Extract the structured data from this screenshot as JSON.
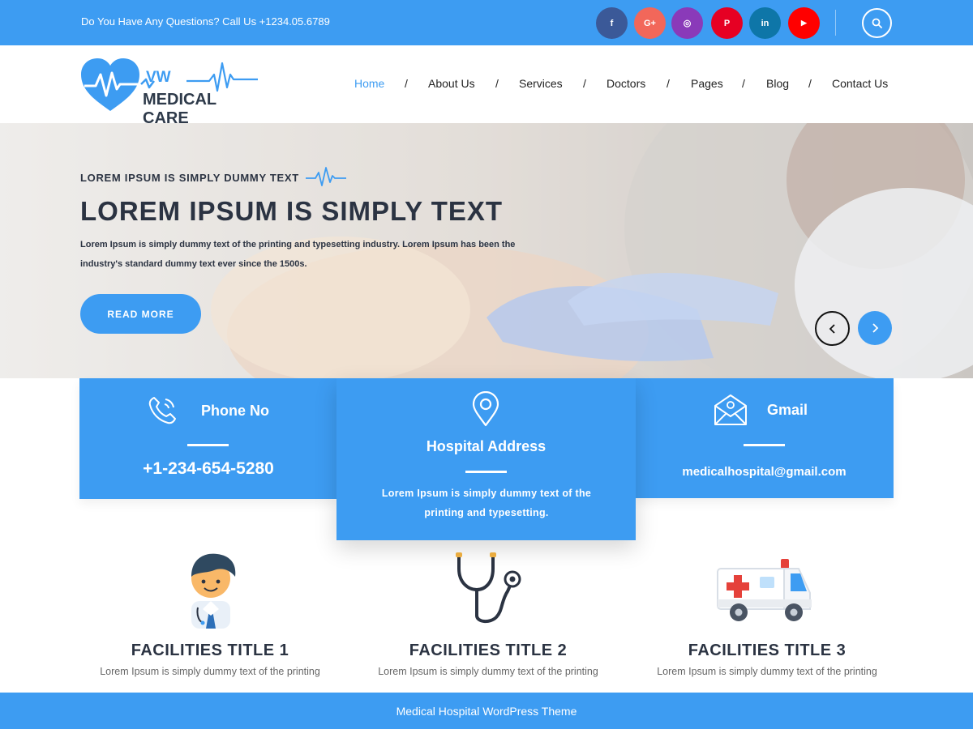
{
  "colors": {
    "accent": "#3d9cf2",
    "dark_text": "#2b3342",
    "facebook": "#3b5998",
    "google_plus": "#f2675a",
    "instagram": "#8a3ab9",
    "pinterest": "#e60023",
    "linkedin": "#0e76a8",
    "youtube": "#ff0000"
  },
  "topbar": {
    "question": "Do You Have Any Questions? Call Us +1234.05.6789",
    "socials": [
      {
        "icon": "facebook-icon",
        "glyph": "f"
      },
      {
        "icon": "google-plus-icon",
        "glyph": "G+"
      },
      {
        "icon": "instagram-icon",
        "glyph": "◎"
      },
      {
        "icon": "pinterest-icon",
        "glyph": "P"
      },
      {
        "icon": "linkedin-icon",
        "glyph": "in"
      },
      {
        "icon": "youtube-icon",
        "glyph": "▶"
      }
    ],
    "search_icon": "search-icon"
  },
  "header": {
    "logo": {
      "line1": "VW",
      "line2": "MEDICAL CARE"
    },
    "nav": [
      "Home",
      "About Us",
      "Services",
      "Doctors",
      "Pages",
      "Blog",
      "Contact Us"
    ],
    "nav_separator": "/",
    "active_index": 0
  },
  "hero": {
    "subtitle": "LOREM IPSUM IS SIMPLY DUMMY TEXT",
    "title": "LOREM IPSUM IS SIMPLY TEXT",
    "description": "Lorem Ipsum is simply dummy text of the printing and typesetting industry. Lorem Ipsum has been the industry's standard dummy text ever since the 1500s.",
    "button": "READ MORE",
    "prev_icon": "chevron-left-icon",
    "next_icon": "chevron-right-icon"
  },
  "info": {
    "phone": {
      "title": "Phone No",
      "value": "+1-234-654-5280",
      "icon": "phone-icon"
    },
    "address": {
      "title": "Hospital Address",
      "value": "Lorem Ipsum is simply dummy text of the printing and typesetting.",
      "icon": "location-pin-icon"
    },
    "mail": {
      "title": "Gmail",
      "value": "medicalhospital@gmail.com",
      "icon": "envelope-icon"
    }
  },
  "facilities": [
    {
      "title": "FACILITIES TITLE 1",
      "desc": "Lorem Ipsum is simply dummy text of the printing",
      "icon": "doctor-icon"
    },
    {
      "title": "FACILITIES TITLE 2",
      "desc": "Lorem Ipsum is simply dummy text of the printing",
      "icon": "stethoscope-icon"
    },
    {
      "title": "FACILITIES TITLE 3",
      "desc": "Lorem Ipsum is simply dummy text of the printing",
      "icon": "ambulance-icon"
    }
  ],
  "footer": {
    "text": "Medical Hospital WordPress Theme"
  }
}
